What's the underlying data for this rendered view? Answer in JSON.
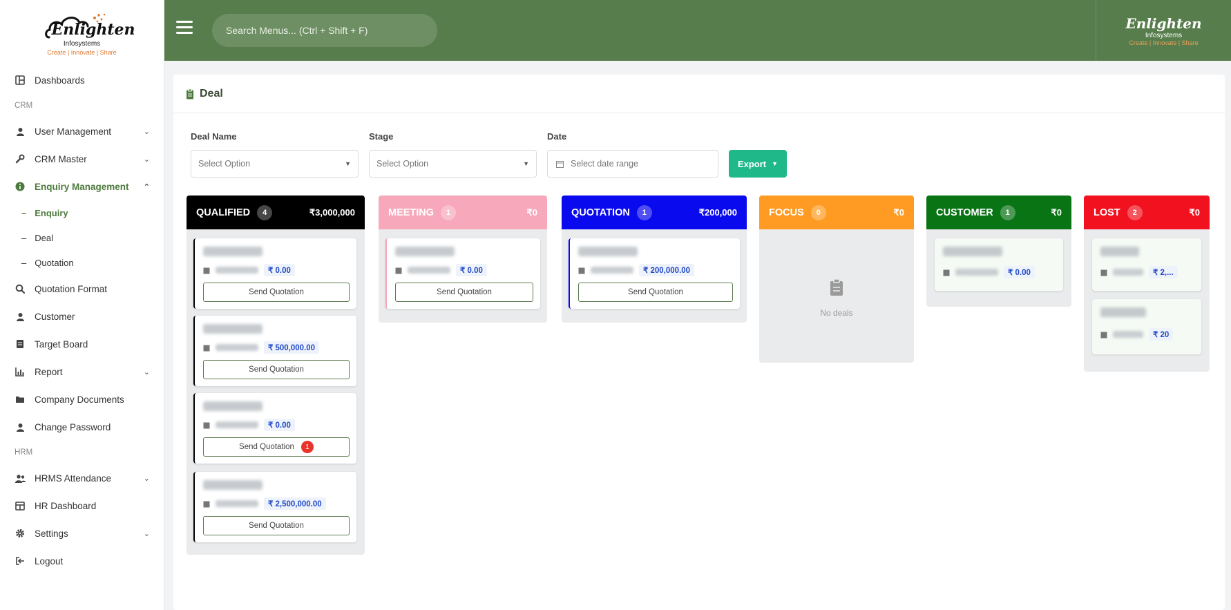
{
  "brand": {
    "name": "Enlighten",
    "sub": "Infosystems",
    "tagline": "Create | Innovate | Share"
  },
  "topbar": {
    "search_placeholder": "Search Menus... (Ctrl + Shift + F)"
  },
  "sidebar": {
    "dashboards": "Dashboards",
    "section_crm": "CRM",
    "user_management": "User Management",
    "crm_master": "CRM Master",
    "enquiry_management": "Enquiry Management",
    "sub_enquiry": "Enquiry",
    "sub_deal": "Deal",
    "sub_quotation": "Quotation",
    "quotation_format": "Quotation Format",
    "customer": "Customer",
    "target_board": "Target Board",
    "report": "Report",
    "company_documents": "Company Documents",
    "change_password": "Change Password",
    "section_hrm": "HRM",
    "hrms_attendance": "HRMS Attendance",
    "hr_dashboard": "HR Dashboard",
    "settings": "Settings",
    "logout": "Logout"
  },
  "page": {
    "title": "Deal"
  },
  "filters": {
    "deal_name_label": "Deal Name",
    "deal_name_value": "Select Option",
    "stage_label": "Stage",
    "stage_value": "Select Option",
    "date_label": "Date",
    "date_placeholder": "Select date range",
    "export_label": "Export"
  },
  "board": {
    "columns": [
      {
        "name": "QUALIFIED",
        "count": "4",
        "amount": "₹3,000,000",
        "color": "#000000"
      },
      {
        "name": "MEETING",
        "count": "1",
        "amount": "₹0",
        "color": "#f7a8bb"
      },
      {
        "name": "QUOTATION",
        "count": "1",
        "amount": "₹200,000",
        "color": "#0a0aef"
      },
      {
        "name": "FOCUS",
        "count": "0",
        "amount": "₹0",
        "color": "#ff9b22"
      },
      {
        "name": "CUSTOMER",
        "count": "1",
        "amount": "₹0",
        "color": "#087414"
      },
      {
        "name": "LOST",
        "count": "2",
        "amount": "₹0",
        "color": "#f2121f"
      }
    ],
    "deals": {
      "q1_amount": "₹ 0.00",
      "q2_amount": "₹ 500,000.00",
      "q3_amount": "₹ 0.00",
      "q4_amount": "₹ 2,500,000.00",
      "m1_amount": "₹ 0.00",
      "qt1_amount": "₹ 200,000.00",
      "c1_amount": "₹ 0.00",
      "l1_amount": "₹ 2,...",
      "l2_amount": "₹ 20",
      "send_label": "Send Quotation",
      "q3_badge": "1"
    },
    "focus_empty": "No deals"
  }
}
